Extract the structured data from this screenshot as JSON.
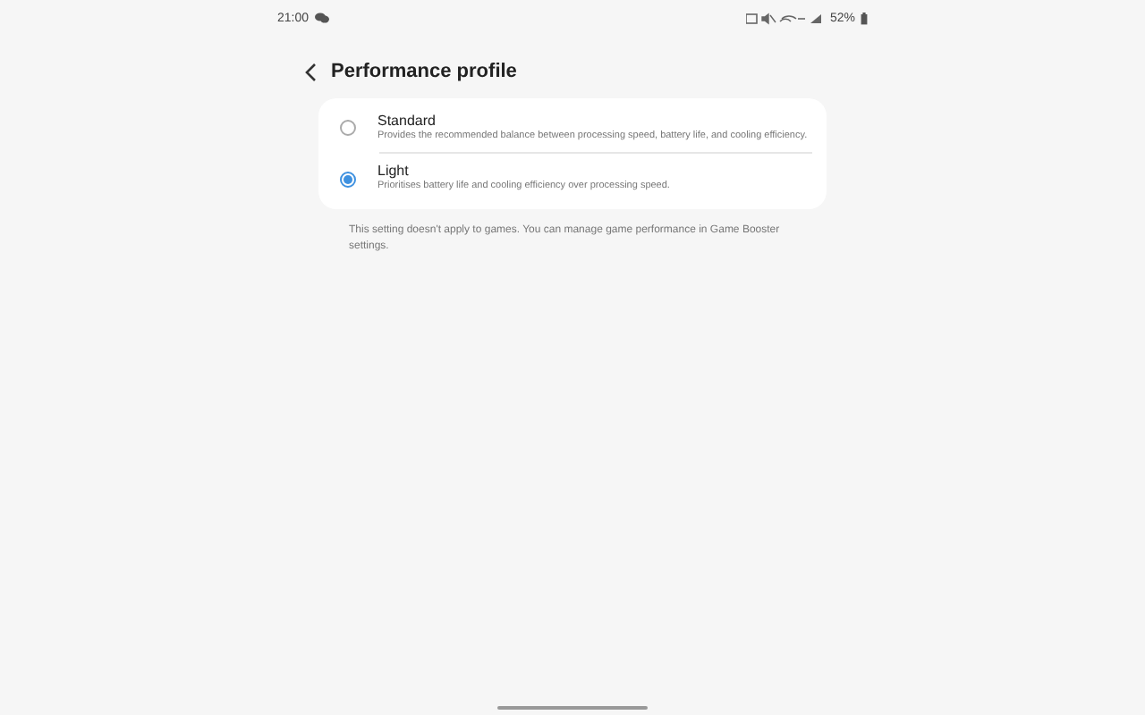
{
  "status_bar": {
    "time": "21:00",
    "battery": "52%"
  },
  "header": {
    "title": "Performance profile"
  },
  "options": [
    {
      "label": "Standard",
      "description": "Provides the recommended balance between processing speed, battery life, and cooling efficiency.",
      "selected": false
    },
    {
      "label": "Light",
      "description": "Prioritises battery life and cooling efficiency over processing speed.",
      "selected": true
    }
  ],
  "footnote": "This setting doesn't apply to games. You can manage game performance in Game Booster settings."
}
